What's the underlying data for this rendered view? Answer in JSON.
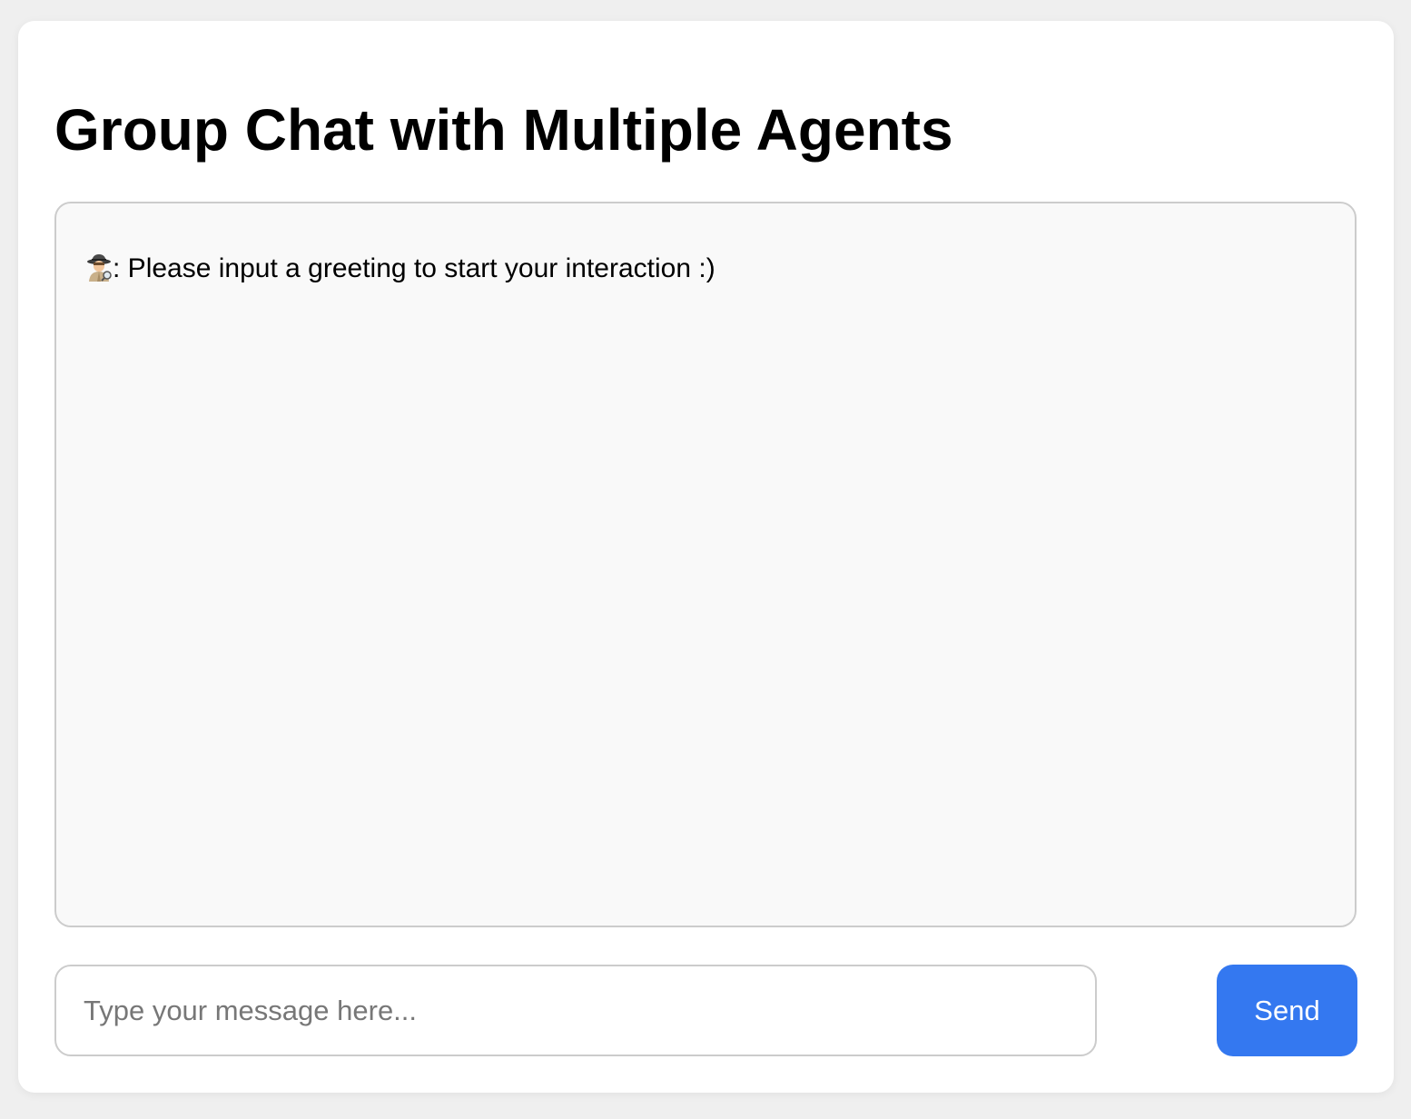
{
  "header": {
    "title": "Group Chat with Multiple Agents"
  },
  "chat": {
    "messages": [
      {
        "sender_icon": "detective-icon",
        "separator": ":",
        "text": " Please input a greeting to start your interaction :)"
      }
    ]
  },
  "composer": {
    "value": "",
    "placeholder": "Type your message here...",
    "send_label": "Send"
  },
  "colors": {
    "page_background": "#efefef",
    "card_background": "#ffffff",
    "chat_background": "#f9f9f9",
    "border": "#cccccc",
    "accent": "#3478f0",
    "placeholder": "#777777"
  }
}
